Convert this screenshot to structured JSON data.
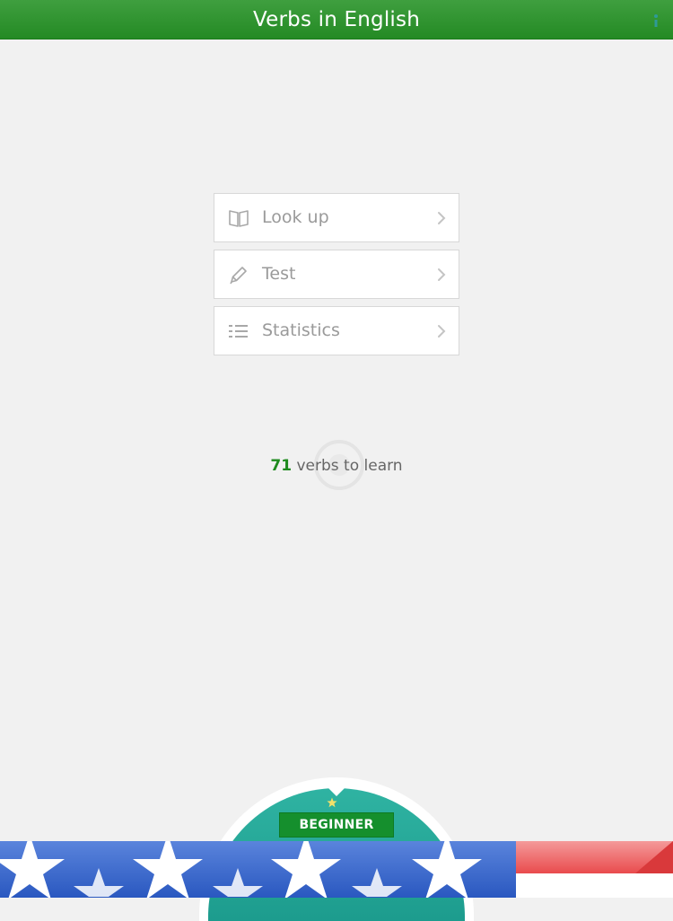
{
  "header": {
    "title": "Verbs in English",
    "color": "#2e962e"
  },
  "menu": {
    "items": [
      {
        "label": "Look up",
        "icon": "book-icon"
      },
      {
        "label": "Test",
        "icon": "pencil-icon"
      },
      {
        "label": "Statistics",
        "icon": "list-icon"
      }
    ]
  },
  "progress": {
    "count": "71",
    "suffix": " verbs to learn"
  },
  "level": {
    "label": "BEGINNER",
    "badge_color": "#158f2d",
    "dome_color": "#22a797"
  },
  "flag": {
    "blue": "#2f5fc4",
    "red": "#e8484a"
  }
}
